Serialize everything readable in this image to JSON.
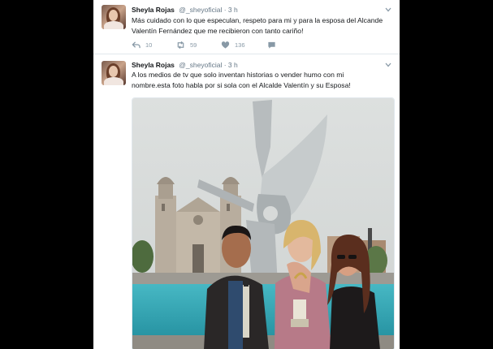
{
  "tweets": [
    {
      "name": "Sheyla Rojas",
      "handle": "@_sheyoficial",
      "time": "· 3 h",
      "lines": [
        "Más cuidado con lo que especulan, respeto para mi y para la esposa del Alcande",
        "Valentín Fernández que me recibieron con tanto cariño!"
      ],
      "reply_count": "10",
      "retweet_count": "59",
      "like_count": "136"
    },
    {
      "name": "Sheyla Rojas",
      "handle": "@_sheyoficial",
      "time": "· 3 h",
      "lines": [
        "A los medios de tv que solo inventan historias o vender humo con mi",
        "nombre.esta foto habla por si sola con el Alcalde Valentín y su Esposa!"
      ]
    }
  ],
  "icons": [
    "reply-icon",
    "retweet-icon",
    "like-icon",
    "dm-icon",
    "chevron-down-icon"
  ],
  "colors": {
    "name": "#14171a",
    "meta": "#657786",
    "action": "#8899a6",
    "background": "#000000"
  }
}
